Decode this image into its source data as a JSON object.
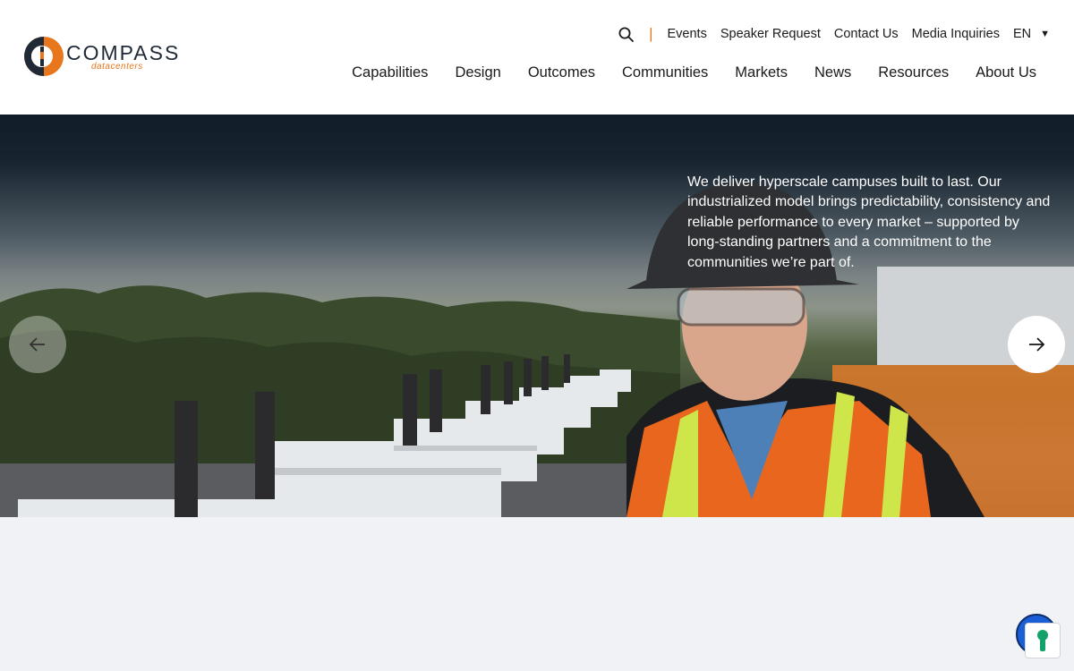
{
  "brand": {
    "name": "COMPASS",
    "tagline": "datacenters",
    "accent_color": "#e8761c",
    "dark_color": "#1f2a36"
  },
  "utility_nav": {
    "search_icon": "search-icon",
    "links": [
      "Events",
      "Speaker Request",
      "Contact Us",
      "Media Inquiries"
    ],
    "language": "EN"
  },
  "main_nav": {
    "items": [
      "Capabilities",
      "Design",
      "Outcomes",
      "Communities",
      "Markets",
      "News",
      "Resources",
      "About Us"
    ]
  },
  "hero": {
    "text": "We deliver hyperscale campuses built to last. Our industrialized model brings predictability, consistency and reliable performance to every market – supported by long-standing partners and a commitment to the communities we’re part of.",
    "prev_icon": "arrow-left-icon",
    "next_icon": "arrow-right-icon"
  },
  "widget": {
    "icon": "keyhole-icon",
    "color": "#1a5fd6"
  }
}
